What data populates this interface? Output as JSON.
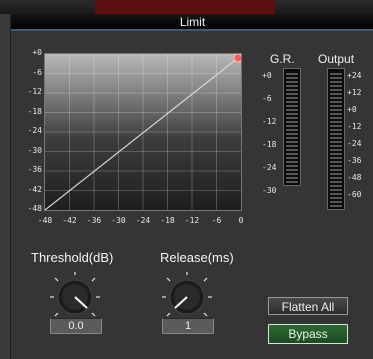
{
  "window": {
    "title": "Limit"
  },
  "graph": {
    "y_ticks": [
      "+0",
      "-6",
      "-12",
      "-18",
      "-24",
      "-30",
      "-36",
      "-42",
      "-48"
    ],
    "x_ticks": [
      "-48",
      "-42",
      "-36",
      "-30",
      "-24",
      "-18",
      "-12",
      "-6",
      "0"
    ],
    "line_color": "#d8d8d8",
    "handle_color": "#ff5a5a"
  },
  "gr_meter": {
    "label": "G.R.",
    "scale": [
      "+0",
      "-6",
      "-12",
      "-18",
      "-24",
      "-30"
    ]
  },
  "output_meter": {
    "label": "Output",
    "scale": [
      "+24",
      "+12",
      "+0",
      "-12",
      "-24",
      "-36",
      "-48",
      "-60"
    ]
  },
  "threshold": {
    "label": "Threshold(dB)",
    "value": "0.0"
  },
  "release": {
    "label": "Release(ms)",
    "value": "1"
  },
  "buttons": {
    "flatten_all": "Flatten All",
    "bypass": "Bypass"
  },
  "colors": {
    "bypass_active": "#2e6b34",
    "title_accent": "#3a5e7a"
  }
}
